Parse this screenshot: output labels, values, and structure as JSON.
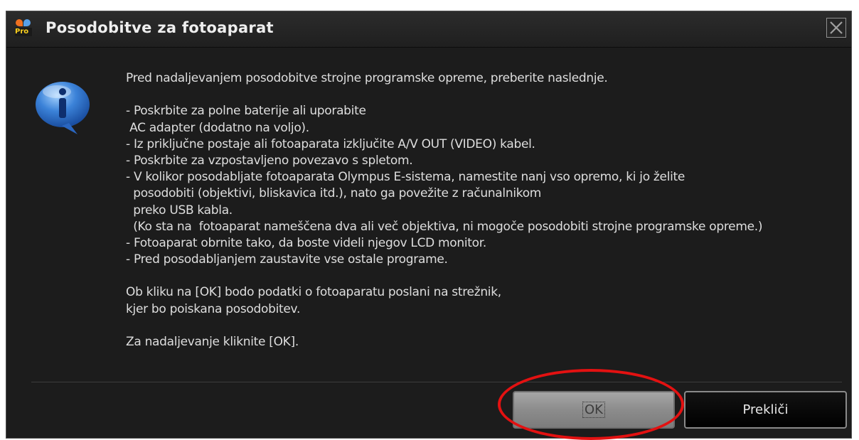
{
  "window": {
    "title": "Posodobitve za fotoaparat",
    "app_icon": "olympus-viewer-pro-icon",
    "app_icon_text": "Pro"
  },
  "content": {
    "icon": "info-icon",
    "lines": [
      "Pred nadaljevanjem posodobitve strojne programske opreme, preberite naslednje.",
      "",
      "- Poskrbite za polne baterije ali uporabite",
      " AC adapter (dodatno na voljo).",
      "- Iz priključne postaje ali fotoaparata izključite A/V OUT (VIDEO) kabel.",
      "- Poskrbite za vzpostavljeno povezavo s spletom.",
      "- V kolikor posodabljate fotoaparata Olympus E-sistema, namestite nanj vso opremo, ki jo želite",
      "  posodobiti (objektivi, bliskavica itd.), nato ga povežite z računalnikom",
      "  preko USB kabla.",
      "  (Ko sta na  fotoaparat nameščena dva ali več objektiva, ni mogoče posodobiti strojne programske opreme.)",
      "- Fotoaparat obrnite tako, da boste videli njegov LCD monitor.",
      "- Pred posodabljanjem zaustavite vse ostale programe.",
      "",
      "Ob kliku na [OK] bodo podatki o fotoaparatu poslani na strežnik,",
      "kjer bo poiskana posodobitev.",
      "",
      "Za nadaljevanje kliknite [OK]."
    ]
  },
  "buttons": {
    "ok_label": "OK",
    "cancel_label": "Prekliči"
  },
  "colors": {
    "background": "#1c1c1c",
    "text": "#dedede",
    "highlight": "#e31111"
  }
}
